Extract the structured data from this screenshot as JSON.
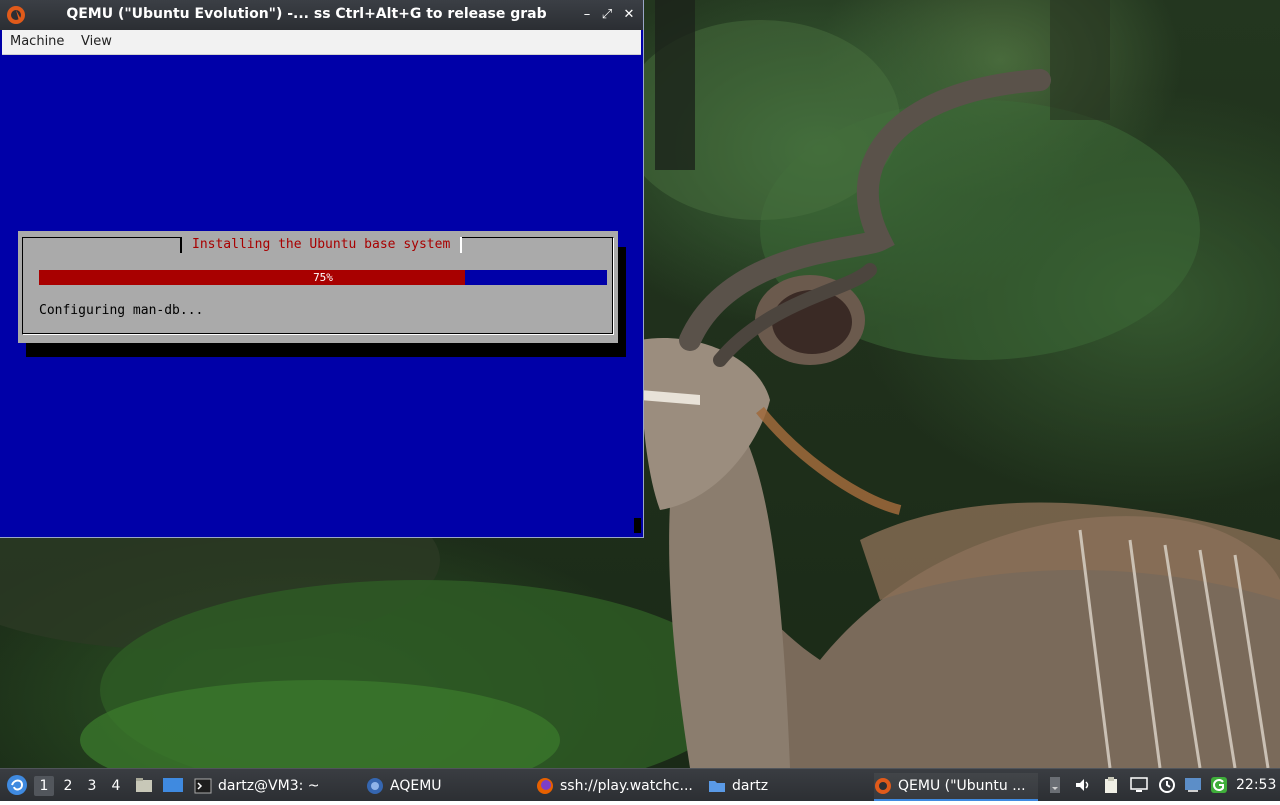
{
  "window": {
    "title": "QEMU (\"Ubuntu Evolution\") -... ss Ctrl+Alt+G to release grab",
    "buttons": {
      "minimize": "–",
      "maximize": "⤢",
      "close": "✕"
    },
    "menu": [
      "Machine",
      "View"
    ]
  },
  "installer": {
    "dialog_title": "Installing the Ubuntu base system",
    "progress_percent": 75,
    "progress_label": "75%",
    "status": "Configuring man-db..."
  },
  "taskbar": {
    "workspaces": [
      "1",
      "2",
      "3",
      "4"
    ],
    "active_workspace": 0,
    "tasks": [
      {
        "label": "dartz@VM3: ~",
        "icon": "terminal-icon"
      },
      {
        "label": "AQEMU",
        "icon": "aqemu-icon"
      },
      {
        "label": "ssh://play.watchc...",
        "icon": "firefox-icon"
      },
      {
        "label": "dartz",
        "icon": "folder-icon"
      },
      {
        "label": "QEMU (\"Ubuntu ...",
        "icon": "qemu-icon"
      }
    ],
    "clock": "22:53"
  },
  "colors": {
    "vm_background": "#0000a8",
    "dialog_gray": "#aaaaaa",
    "dialog_title_red": "#a80000",
    "progress_fill": "#a80000",
    "taskbar_accent": "#3f8ae0"
  }
}
